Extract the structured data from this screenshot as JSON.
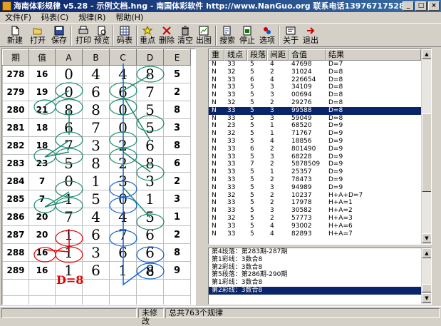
{
  "window": {
    "title": "海南体彩规律 v5.28 - 示例文档.hng - 南国体彩软件 http://www.NanGuo.org  联系电话13976717528",
    "minimize": "_",
    "maximize": "□",
    "close": "×"
  },
  "menu": [
    {
      "label": "文件(F)"
    },
    {
      "label": "码表(C)"
    },
    {
      "label": "规律(R)"
    },
    {
      "label": "帮助(H)"
    }
  ],
  "toolbar": [
    {
      "label": "新建",
      "icon": "new-file-icon"
    },
    {
      "label": "打开",
      "icon": "open-folder-icon"
    },
    {
      "label": "保存",
      "icon": "save-disk-icon"
    },
    {
      "label": "打印",
      "icon": "printer-icon"
    },
    {
      "label": "预览",
      "icon": "preview-icon"
    },
    {
      "label": "码表",
      "icon": "table-icon"
    },
    {
      "label": "重点",
      "icon": "star-icon"
    },
    {
      "label": "删除",
      "icon": "delete-x-icon"
    },
    {
      "label": "清空",
      "icon": "trash-icon"
    },
    {
      "label": "出图",
      "icon": "chart-icon"
    },
    {
      "label": "搜索",
      "icon": "search-icon"
    },
    {
      "label": "停止",
      "icon": "stop-icon"
    },
    {
      "label": "选项",
      "icon": "options-icon"
    },
    {
      "label": "关于",
      "icon": "about-icon"
    },
    {
      "label": "退出",
      "icon": "exit-arrow-icon"
    }
  ],
  "grid": {
    "headers": [
      "期",
      "值",
      "A",
      "B",
      "C",
      "D",
      "E"
    ],
    "rows": [
      [
        "278",
        "16",
        "0",
        "4",
        "4",
        "8",
        "5"
      ],
      [
        "279",
        "19",
        "0",
        "6",
        "6",
        "7",
        "2"
      ],
      [
        "280",
        "21",
        "8",
        "8",
        "0",
        "5",
        "8"
      ],
      [
        "281",
        "18",
        "6",
        "7",
        "0",
        "5",
        "3"
      ],
      [
        "282",
        "18",
        "7",
        "3",
        "2",
        "6",
        "8"
      ],
      [
        "283",
        "23",
        "5",
        "8",
        "2",
        "8",
        "6"
      ],
      [
        "284",
        "7",
        "0",
        "1",
        "3",
        "3",
        "2"
      ],
      [
        "285",
        "7",
        "1",
        "5",
        "0",
        "1",
        "3"
      ],
      [
        "286",
        "20",
        "7",
        "4",
        "4",
        "5",
        "1"
      ],
      [
        "287",
        "20",
        "1",
        "6",
        "7",
        "6",
        "2"
      ],
      [
        "288",
        "16",
        "1",
        "3",
        "6",
        "6",
        "8"
      ],
      [
        "289",
        "16",
        "1",
        "6",
        "1",
        "8",
        "9"
      ]
    ],
    "projected_value": "8",
    "result_label": "D=8"
  },
  "list": {
    "headers": [
      "重",
      "线点",
      "段落",
      "间距",
      "合值",
      "结果"
    ],
    "rows": [
      [
        "N",
        "33",
        "5",
        "4",
        "47698",
        "D=7"
      ],
      [
        "N",
        "32",
        "5",
        "2",
        "31024",
        "D=8"
      ],
      [
        "N",
        "33",
        "6",
        "4",
        "226654",
        "D=8"
      ],
      [
        "N",
        "33",
        "5",
        "3",
        "34109",
        "D=8"
      ],
      [
        "N",
        "33",
        "5",
        "3",
        "00694",
        "D=8"
      ],
      [
        "N",
        "32",
        "5",
        "2",
        "29276",
        "D=8"
      ],
      [
        "N",
        "33",
        "5",
        "3",
        "99588",
        "D=8"
      ],
      [
        "N",
        "33",
        "5",
        "3",
        "59049",
        "D=8"
      ],
      [
        "N",
        "23",
        "5",
        "1",
        "68520",
        "D=9"
      ],
      [
        "N",
        "32",
        "5",
        "1",
        "71767",
        "D=9"
      ],
      [
        "N",
        "33",
        "5",
        "4",
        "18856",
        "D=9"
      ],
      [
        "N",
        "33",
        "6",
        "2",
        "801490",
        "D=9"
      ],
      [
        "N",
        "33",
        "5",
        "3",
        "68228",
        "D=9"
      ],
      [
        "N",
        "33",
        "7",
        "2",
        "5878509",
        "D=9"
      ],
      [
        "N",
        "33",
        "5",
        "1",
        "25357",
        "D=9"
      ],
      [
        "N",
        "33",
        "5",
        "2",
        "78473",
        "D=9"
      ],
      [
        "N",
        "33",
        "5",
        "3",
        "94989",
        "D=9"
      ],
      [
        "N",
        "32",
        "5",
        "2",
        "10237",
        "H+A+D=7"
      ],
      [
        "N",
        "33",
        "5",
        "2",
        "17978",
        "H+A=1"
      ],
      [
        "N",
        "33",
        "5",
        "3",
        "30582",
        "H+A=2"
      ],
      [
        "N",
        "32",
        "5",
        "2",
        "57773",
        "H+A=3"
      ],
      [
        "N",
        "33",
        "5",
        "4",
        "93002",
        "H+A=6"
      ],
      [
        "N",
        "33",
        "5",
        "4",
        "82893",
        "H+A=7"
      ]
    ],
    "selected_index": 6
  },
  "log": {
    "lines": [
      "第4段落：第283期-287期",
      "第1彩线：3数合8",
      "第2彩线：3数合8",
      "第5段落：第286期-290期",
      "第1彩线：3数合8",
      "第2彩线：3数合8"
    ],
    "selected_index": 5
  },
  "status": {
    "left": "",
    "modified": "未修改",
    "total": "总共763个规律"
  },
  "colors": {
    "titlebar": "#0a246a",
    "green_marker": "#1a8a70",
    "red_marker": "#e00000",
    "blue_marker": "#1060d0",
    "selection": "#0a246a"
  }
}
